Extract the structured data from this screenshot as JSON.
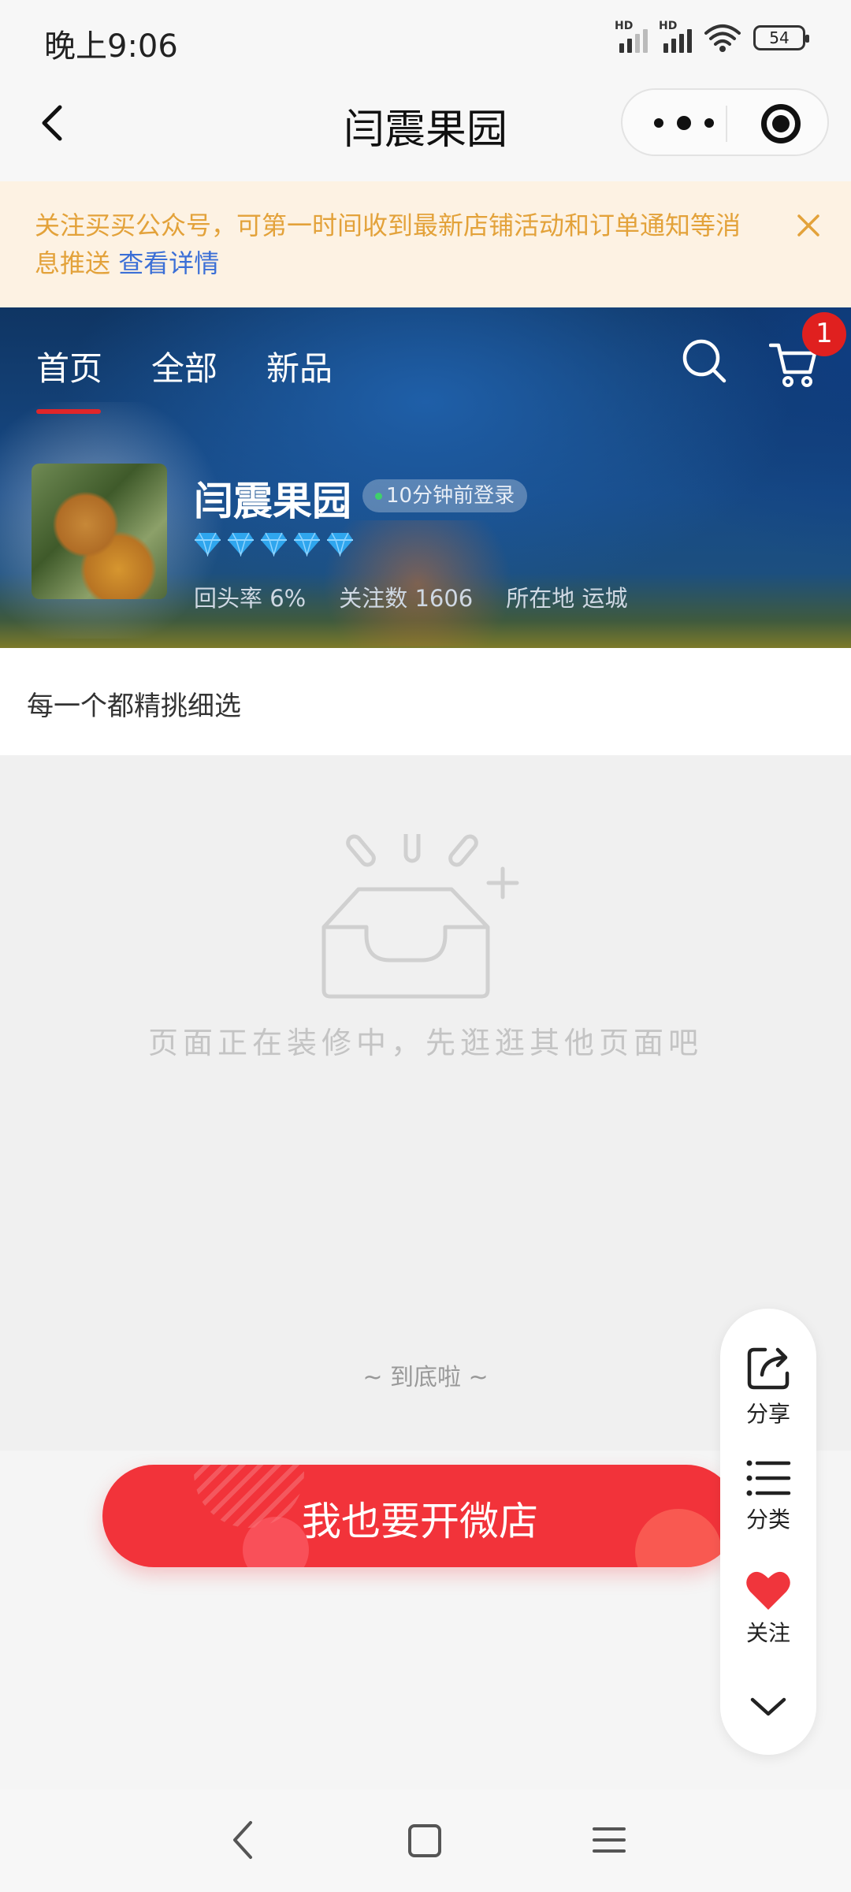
{
  "status_bar": {
    "time": "晚上9:06",
    "signal_labels": [
      "HD",
      "HD"
    ],
    "battery_level": "54"
  },
  "nav_bar": {
    "title": "闫震果园",
    "icons": [
      "back-arrow-icon",
      "more-dots-icon",
      "target-icon"
    ]
  },
  "notice": {
    "text": "关注买买公众号，可第一时间收到最新店铺活动和订单通知等消息推送",
    "link_text": "查看详情",
    "close_icon": "close-icon"
  },
  "shop_header": {
    "tabs": [
      {
        "label": "首页",
        "active": true
      },
      {
        "label": "全部",
        "active": false
      },
      {
        "label": "新品",
        "active": false
      }
    ],
    "cart_badge": "1",
    "shop_name": "闫震果园",
    "login_status": "10分钟前登录",
    "diamond_rating": 5,
    "stats": [
      "回头率 6%",
      "关注数 1606",
      "所在地 运城"
    ]
  },
  "slogan": "每一个都精挑细选",
  "empty_state": {
    "message": "页面正在装修中，先逛逛其他页面吧",
    "end_text": "~ 到底啦 ~"
  },
  "cta_button": "我也要开微店",
  "float_panel": {
    "items": [
      {
        "label": "分享",
        "icon": "share-icon"
      },
      {
        "label": "分类",
        "icon": "list-icon"
      },
      {
        "label": "关注",
        "icon": "heart-icon"
      }
    ],
    "collapse_icon": "chevron-down-icon"
  },
  "colors": {
    "accent_red": "#f2333a",
    "notice_text": "#e3a23a",
    "link_blue": "#3b6fd6",
    "gem_blue": "#2fa6ee"
  }
}
